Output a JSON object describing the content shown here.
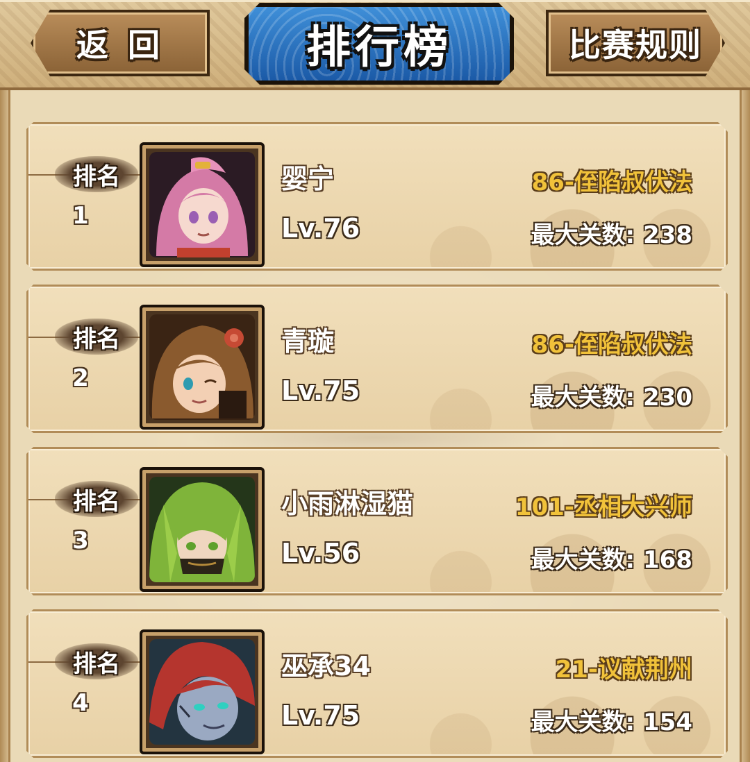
{
  "header": {
    "back_label": "返 回",
    "title": "排行榜",
    "rules_label": "比赛规则"
  },
  "colors": {
    "title_plate": "#2e75c4",
    "stage_text": "#f1c23a",
    "card_bg": "#ecd8b0"
  },
  "ranking": [
    {
      "rank_label": "排名",
      "rank": "1",
      "name": "婴宁",
      "level": "Lv.76",
      "stage": "86-侄陷叔伏法",
      "max_label": "最大关数:",
      "max_value": "238",
      "avatar_icon": "pink-hair-heroine-portrait",
      "avatar_color": "#c7709a"
    },
    {
      "rank_label": "排名",
      "rank": "2",
      "name": "青璇",
      "level": "Lv.75",
      "stage": "86-侄陷叔伏法",
      "max_label": "最大关数:",
      "max_value": "230",
      "avatar_icon": "brown-hair-heroine-portrait",
      "avatar_color": "#8a5a2e"
    },
    {
      "rank_label": "排名",
      "rank": "3",
      "name": "小雨淋湿猫",
      "level": "Lv.56",
      "stage": "101-丞相大兴师",
      "max_label": "最大关数:",
      "max_value": "168",
      "avatar_icon": "green-hair-hero-portrait",
      "avatar_color": "#7fb43a"
    },
    {
      "rank_label": "排名",
      "rank": "4",
      "name": "巫承34",
      "level": "Lv.75",
      "stage": "21-议献荆州",
      "max_label": "最大关数:",
      "max_value": "154",
      "avatar_icon": "red-hair-hero-portrait",
      "avatar_color": "#b5352e"
    }
  ]
}
